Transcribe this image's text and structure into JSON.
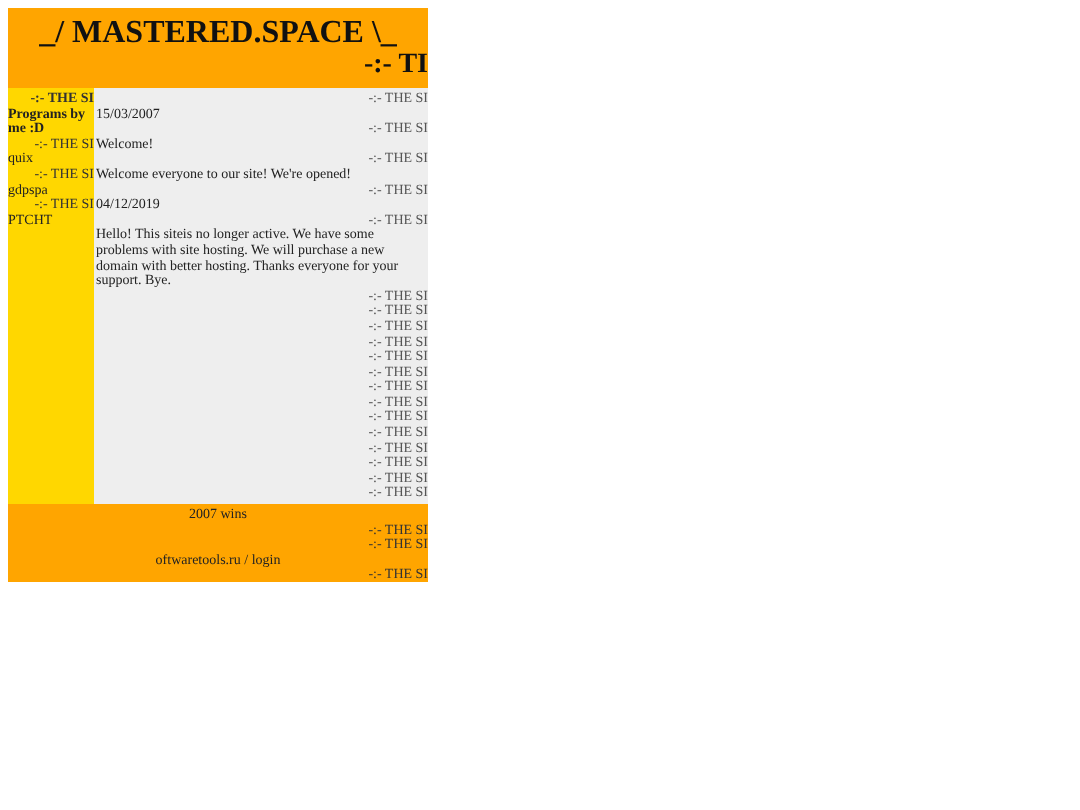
{
  "header": {
    "title": "_/ MASTERED.SPACE \\_",
    "marquee": "-:- TI"
  },
  "sidebar": {
    "items": [
      {
        "kind": "marquee",
        "text": "-:- THE SI",
        "bold": true
      },
      {
        "kind": "text",
        "text": "Programs by me :D",
        "bold": true
      },
      {
        "kind": "marquee",
        "text": "-:- THE SI",
        "bold": false
      },
      {
        "kind": "text",
        "text": "quix",
        "bold": false
      },
      {
        "kind": "marquee",
        "text": "-:- THE SI",
        "bold": false
      },
      {
        "kind": "text",
        "text": "gdpspa",
        "bold": false
      },
      {
        "kind": "marquee",
        "text": "-:- THE SI",
        "bold": false
      },
      {
        "kind": "text",
        "text": "PTCHT",
        "bold": false
      }
    ]
  },
  "main": {
    "items": [
      {
        "kind": "marquee",
        "text": "-:- THE SI"
      },
      {
        "kind": "text",
        "text": "15/03/2007"
      },
      {
        "kind": "marquee",
        "text": "-:- THE SI"
      },
      {
        "kind": "text",
        "text": "Welcome!"
      },
      {
        "kind": "marquee",
        "text": "-:- THE SI"
      },
      {
        "kind": "text",
        "text": "Welcome everyone to our site! We're opened!"
      },
      {
        "kind": "marquee",
        "text": "-:- THE SI"
      },
      {
        "kind": "text",
        "text": "04/12/2019"
      },
      {
        "kind": "marquee",
        "text": "-:- THE SI"
      },
      {
        "kind": "text",
        "text": "Hello! This siteis no longer active. We have some problems with site hosting. We will purchase a new domain with better hosting. Thanks everyone for your support. Bye."
      },
      {
        "kind": "marquee",
        "text": "-:- THE SI"
      },
      {
        "kind": "marquee",
        "text": "-:- THE SI"
      },
      {
        "kind": "marquee",
        "text": "-:- THE SI"
      },
      {
        "kind": "marquee",
        "text": "-:- THE SI"
      },
      {
        "kind": "marquee",
        "text": "-:- THE SI"
      },
      {
        "kind": "marquee",
        "text": "-:- THE SI"
      },
      {
        "kind": "marquee",
        "text": "-:- THE SI"
      },
      {
        "kind": "marquee",
        "text": "-:- THE SI"
      },
      {
        "kind": "marquee",
        "text": "-:- THE SI"
      },
      {
        "kind": "marquee",
        "text": "-:- THE SI"
      },
      {
        "kind": "marquee",
        "text": "-:- THE SI"
      },
      {
        "kind": "marquee",
        "text": "-:- THE SI"
      },
      {
        "kind": "marquee",
        "text": "-:- THE SI"
      },
      {
        "kind": "marquee",
        "text": "-:- THE SI"
      }
    ]
  },
  "footer": {
    "items": [
      {
        "kind": "center",
        "text": "2007 wins"
      },
      {
        "kind": "marquee",
        "text": "-:- THE SI"
      },
      {
        "kind": "marquee",
        "text": "-:- THE SI"
      },
      {
        "kind": "link",
        "text": "oftwaretools.ru / login"
      },
      {
        "kind": "marquee",
        "text": "-:- THE SI"
      }
    ]
  }
}
